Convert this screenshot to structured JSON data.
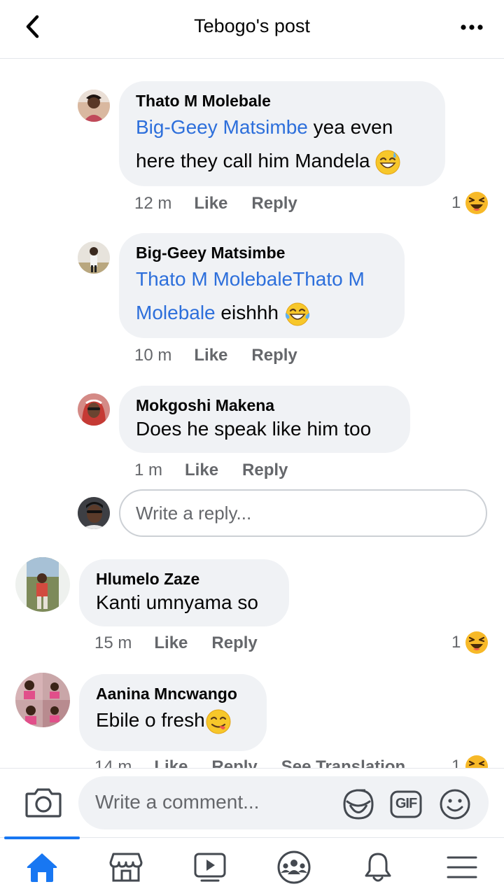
{
  "header": {
    "title": "Tebogo's post",
    "back_icon": "chevron-left-icon",
    "more_icon": "ellipsis-icon"
  },
  "comments": [
    {
      "author": "Thato M Molebale",
      "mention": "Big-Geey  Matsimbe",
      "text_line1": " yea even",
      "text_line2": "here they call him Mandela",
      "emoji": "grinning-sweat-emoji",
      "time": "12 m",
      "like": "Like",
      "reply": "Reply",
      "reaction_count": "1",
      "reaction_icon": "laughing-emoji"
    },
    {
      "author": "Big-Geey  Matsimbe",
      "mention_line1": "Thato M MolebaleThato M",
      "mention_line2": "Molebale",
      "text": " eishhh",
      "emoji": "tears-of-joy-emoji",
      "time": "10 m",
      "like": "Like",
      "reply": "Reply"
    },
    {
      "author": "Mokgoshi Makena",
      "text": "Does he speak like him too",
      "time": "1 m",
      "like": "Like",
      "reply": "Reply"
    },
    {
      "author": "Hlumelo Zaze",
      "text": "Kanti umnyama so",
      "time": "15 m",
      "like": "Like",
      "reply": "Reply",
      "reaction_count": "1",
      "reaction_icon": "laughing-emoji"
    },
    {
      "author": "Aanina Mncwango",
      "text": "Ebile o fresh",
      "emoji": "yum-emoji",
      "time": "14 m",
      "like": "Like",
      "reply": "Reply",
      "see_translation": "See Translation",
      "reaction_count": "1",
      "reaction_icon": "laughing-emoji"
    }
  ],
  "reply_box": {
    "placeholder": "Write a reply..."
  },
  "composer": {
    "placeholder": "Write a comment...",
    "camera_icon": "camera-icon",
    "sticker_icon": "sticker-icon",
    "gif_label": "GIF",
    "emoji_icon": "smiley-icon"
  },
  "tabs": [
    {
      "icon": "home-icon",
      "active": true
    },
    {
      "icon": "marketplace-icon",
      "active": false
    },
    {
      "icon": "watch-icon",
      "active": false
    },
    {
      "icon": "groups-icon",
      "active": false
    },
    {
      "icon": "bell-icon",
      "active": false
    },
    {
      "icon": "menu-icon",
      "active": false
    }
  ],
  "colors": {
    "accent": "#1877f2",
    "mention": "#2d6fdb",
    "bubble": "#f0f2f5",
    "secondary_text": "#65676b",
    "emoji_yellow": "#f7b928"
  }
}
